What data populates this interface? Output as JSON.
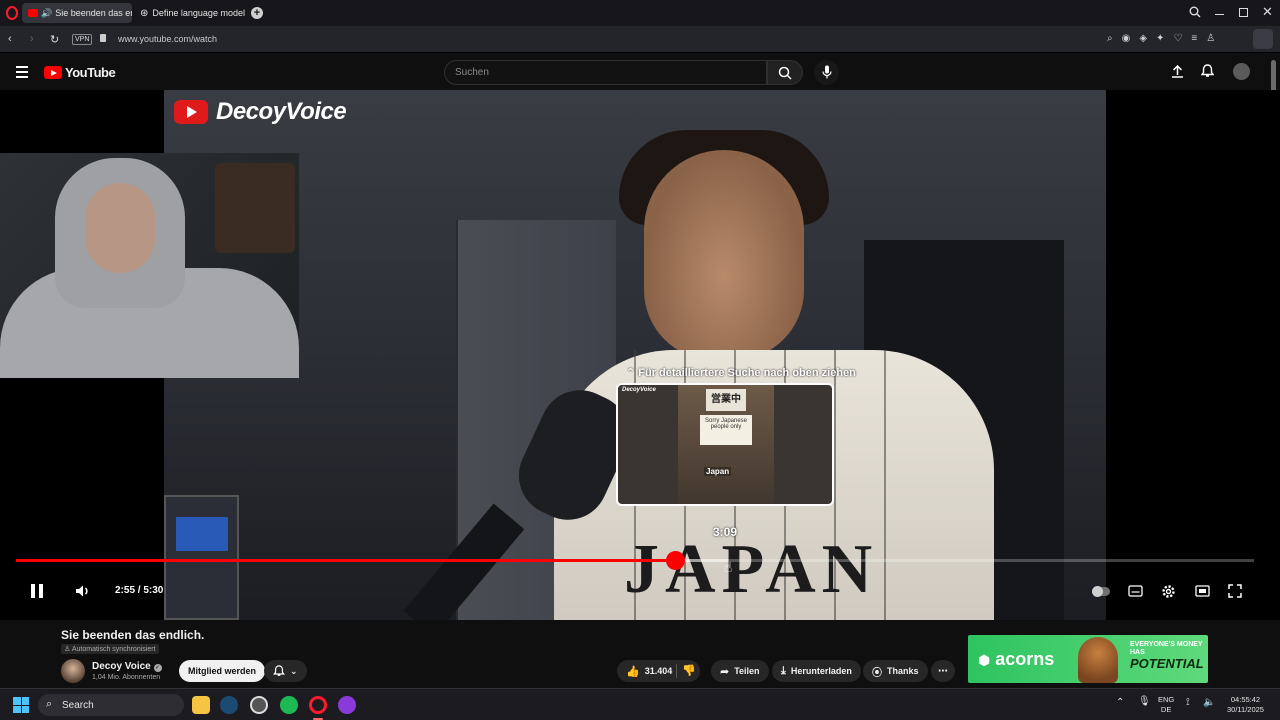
{
  "browser": {
    "tabs": [
      {
        "label": "Sie beenden das endlich."
      },
      {
        "label": "Define language model"
      }
    ],
    "vpn_label": "VPN",
    "url": "www.youtube.com/watch"
  },
  "youtube": {
    "logo_text": "YouTube",
    "search_placeholder": "Suchen"
  },
  "video": {
    "brand_overlay": "DecoyVoice",
    "jersey_text": "JAPAN",
    "seek_hint": "Für detailliertere Suche nach oben ziehen",
    "preview": {
      "brand": "DecoyVoice",
      "sign": "営業中",
      "paper": "Sorry Japanese people only",
      "caption": "Japan"
    },
    "preview_timecode": "3:09",
    "time_display": "2:55 / 5:30",
    "progress": {
      "played_fraction": 0.532,
      "buffered_fraction": 0.575,
      "hover_fraction": 0.575
    }
  },
  "details": {
    "title": "Sie beenden das endlich.",
    "auto_sync": "Automatisch synchronisiert",
    "channel_name": "Decoy Voice",
    "subscribers": "1,04 Mio. Abonnenten",
    "member_button": "Mitglied werden",
    "likes": "31.404",
    "share": "Teilen",
    "download": "Herunterladen",
    "thanks": "Thanks"
  },
  "ad": {
    "brand": "acorns",
    "tagline": "EVERYONE'S MONEY HAS",
    "headline": "POTENTIAL"
  },
  "taskbar": {
    "search_label": "Search",
    "lang_top": "ENG",
    "lang_bottom": "DE",
    "time": "04:55:42",
    "date": "30/11/2025"
  },
  "colors": {
    "accent": "#ff0000",
    "bg": "#0f0f0f",
    "ad_green": "#2ec460"
  }
}
